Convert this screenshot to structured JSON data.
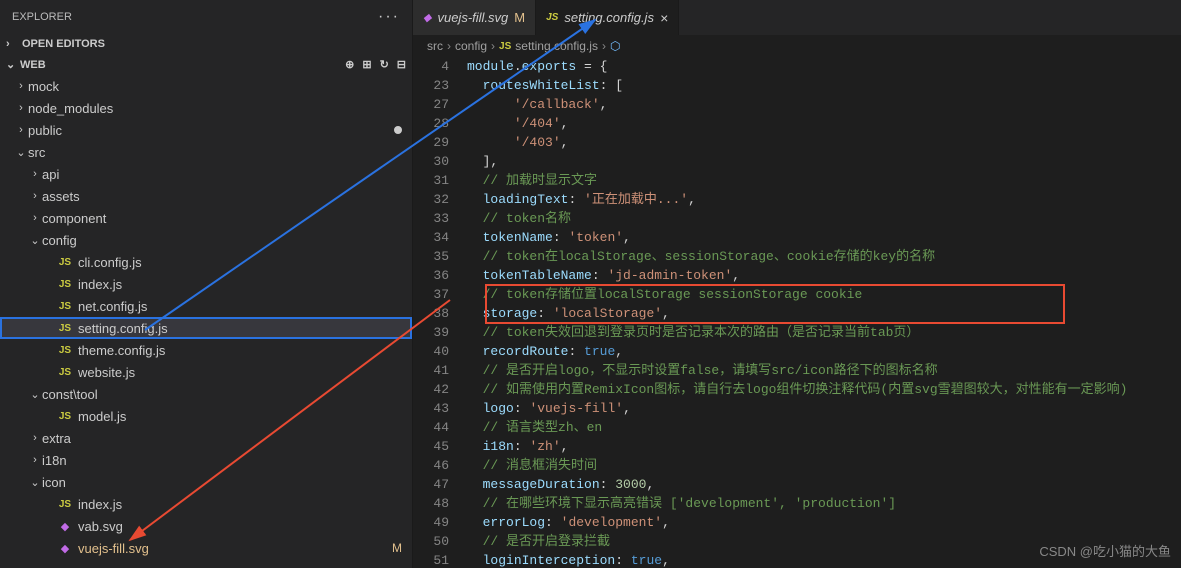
{
  "explorer": {
    "title": "EXPLORER",
    "openEditors": "OPEN EDITORS",
    "workspace": "WEB"
  },
  "tree": [
    {
      "type": "folder",
      "label": "mock",
      "expanded": false,
      "indent": 1
    },
    {
      "type": "folder",
      "label": "node_modules",
      "expanded": false,
      "indent": 1
    },
    {
      "type": "folder",
      "label": "public",
      "expanded": false,
      "indent": 1,
      "modified": true
    },
    {
      "type": "folder",
      "label": "src",
      "expanded": true,
      "indent": 1
    },
    {
      "type": "folder",
      "label": "api",
      "expanded": false,
      "indent": 2
    },
    {
      "type": "folder",
      "label": "assets",
      "expanded": false,
      "indent": 2
    },
    {
      "type": "folder",
      "label": "component",
      "expanded": false,
      "indent": 2
    },
    {
      "type": "folder",
      "label": "config",
      "expanded": true,
      "indent": 2
    },
    {
      "type": "file",
      "label": "cli.config.js",
      "icon": "js",
      "indent": 3
    },
    {
      "type": "file",
      "label": "index.js",
      "icon": "js",
      "indent": 3
    },
    {
      "type": "file",
      "label": "net.config.js",
      "icon": "js",
      "indent": 3
    },
    {
      "type": "file",
      "label": "setting.config.js",
      "icon": "js",
      "indent": 3,
      "highlighted": true
    },
    {
      "type": "file",
      "label": "theme.config.js",
      "icon": "js",
      "indent": 3
    },
    {
      "type": "file",
      "label": "website.js",
      "icon": "js",
      "indent": 3
    },
    {
      "type": "folder",
      "label": "const\\tool",
      "expanded": true,
      "indent": 2
    },
    {
      "type": "file",
      "label": "model.js",
      "icon": "js",
      "indent": 3
    },
    {
      "type": "folder",
      "label": "extra",
      "expanded": false,
      "indent": 2
    },
    {
      "type": "folder",
      "label": "i18n",
      "expanded": false,
      "indent": 2
    },
    {
      "type": "folder",
      "label": "icon",
      "expanded": true,
      "indent": 2
    },
    {
      "type": "file",
      "label": "index.js",
      "icon": "js",
      "indent": 3
    },
    {
      "type": "file",
      "label": "vab.svg",
      "icon": "svg",
      "indent": 3
    },
    {
      "type": "file",
      "label": "vuejs-fill.svg",
      "icon": "svg",
      "indent": 3,
      "modifiedBadge": "M",
      "modifiedLabel": true
    }
  ],
  "tabs": [
    {
      "label": "vuejs-fill.svg",
      "icon": "svg",
      "badge": "M",
      "active": false
    },
    {
      "label": "setting.config.js",
      "icon": "js",
      "active": true,
      "close": true
    }
  ],
  "breadcrumb": [
    "src",
    "config",
    "setting.config.js",
    "<unknown>"
  ],
  "lineNumbers": [
    "4",
    "23",
    "27",
    "28",
    "29",
    "30",
    "31",
    "32",
    "33",
    "34",
    "35",
    "36",
    "37",
    "38",
    "39",
    "40",
    "41",
    "42",
    "43",
    "44",
    "45",
    "46",
    "47",
    "48",
    "49",
    "50",
    "51"
  ],
  "code": [
    [
      {
        "t": "module",
        "c": "prop"
      },
      {
        "t": ".",
        "c": "punc"
      },
      {
        "t": "exports",
        "c": "prop"
      },
      {
        "t": " = {",
        "c": "punc"
      }
    ],
    [
      {
        "t": "  ",
        "c": "punc"
      },
      {
        "t": "routesWhiteList",
        "c": "prop"
      },
      {
        "t": ": [",
        "c": "punc"
      }
    ],
    [
      {
        "t": "      ",
        "c": "punc"
      },
      {
        "t": "'/callback'",
        "c": "str"
      },
      {
        "t": ",",
        "c": "punc"
      }
    ],
    [
      {
        "t": "      ",
        "c": "punc"
      },
      {
        "t": "'/404'",
        "c": "str"
      },
      {
        "t": ",",
        "c": "punc"
      }
    ],
    [
      {
        "t": "      ",
        "c": "punc"
      },
      {
        "t": "'/403'",
        "c": "str"
      },
      {
        "t": ",",
        "c": "punc"
      }
    ],
    [
      {
        "t": "  ],",
        "c": "punc"
      }
    ],
    [
      {
        "t": "  ",
        "c": "punc"
      },
      {
        "t": "// 加载时显示文字",
        "c": "comment"
      }
    ],
    [
      {
        "t": "  ",
        "c": "punc"
      },
      {
        "t": "loadingText",
        "c": "prop"
      },
      {
        "t": ": ",
        "c": "punc"
      },
      {
        "t": "'正在加载中...'",
        "c": "str"
      },
      {
        "t": ",",
        "c": "punc"
      }
    ],
    [
      {
        "t": "  ",
        "c": "punc"
      },
      {
        "t": "// token名称",
        "c": "comment"
      }
    ],
    [
      {
        "t": "  ",
        "c": "punc"
      },
      {
        "t": "tokenName",
        "c": "prop"
      },
      {
        "t": ": ",
        "c": "punc"
      },
      {
        "t": "'token'",
        "c": "str"
      },
      {
        "t": ",",
        "c": "punc"
      }
    ],
    [
      {
        "t": "  ",
        "c": "punc"
      },
      {
        "t": "// token在localStorage、sessionStorage、cookie存储的key的名称",
        "c": "comment"
      }
    ],
    [
      {
        "t": "  ",
        "c": "punc"
      },
      {
        "t": "tokenTableName",
        "c": "prop"
      },
      {
        "t": ": ",
        "c": "punc"
      },
      {
        "t": "'jd-admin-token'",
        "c": "str"
      },
      {
        "t": ",",
        "c": "punc"
      }
    ],
    [
      {
        "t": "  ",
        "c": "punc"
      },
      {
        "t": "// token存储位置localStorage sessionStorage cookie",
        "c": "comment"
      }
    ],
    [
      {
        "t": "  ",
        "c": "punc"
      },
      {
        "t": "storage",
        "c": "prop"
      },
      {
        "t": ": ",
        "c": "punc"
      },
      {
        "t": "'localStorage'",
        "c": "str"
      },
      {
        "t": ",",
        "c": "punc"
      }
    ],
    [
      {
        "t": "  ",
        "c": "punc"
      },
      {
        "t": "// token失效回退到登录页时是否记录本次的路由（是否记录当前tab页）",
        "c": "comment"
      }
    ],
    [
      {
        "t": "  ",
        "c": "punc"
      },
      {
        "t": "recordRoute",
        "c": "prop"
      },
      {
        "t": ": ",
        "c": "punc"
      },
      {
        "t": "true",
        "c": "bool"
      },
      {
        "t": ",",
        "c": "punc"
      }
    ],
    [
      {
        "t": "  ",
        "c": "punc"
      },
      {
        "t": "// 是否开启logo，不显示时设置false，请填写src/icon路径下的图标名称",
        "c": "comment"
      }
    ],
    [
      {
        "t": "  ",
        "c": "punc"
      },
      {
        "t": "// 如需使用内置RemixIcon图标，请自行去logo组件切换注释代码(内置svg雪碧图较大，对性能有一定影响)",
        "c": "comment"
      }
    ],
    [
      {
        "t": "  ",
        "c": "punc"
      },
      {
        "t": "logo",
        "c": "prop"
      },
      {
        "t": ": ",
        "c": "punc"
      },
      {
        "t": "'vuejs-fill'",
        "c": "str"
      },
      {
        "t": ",",
        "c": "punc"
      }
    ],
    [
      {
        "t": "  ",
        "c": "punc"
      },
      {
        "t": "// 语言类型zh、en",
        "c": "comment"
      }
    ],
    [
      {
        "t": "  ",
        "c": "punc"
      },
      {
        "t": "i18n",
        "c": "prop"
      },
      {
        "t": ": ",
        "c": "punc"
      },
      {
        "t": "'zh'",
        "c": "str"
      },
      {
        "t": ",",
        "c": "punc"
      }
    ],
    [
      {
        "t": "  ",
        "c": "punc"
      },
      {
        "t": "// 消息框消失时间",
        "c": "comment"
      }
    ],
    [
      {
        "t": "  ",
        "c": "punc"
      },
      {
        "t": "messageDuration",
        "c": "prop"
      },
      {
        "t": ": ",
        "c": "punc"
      },
      {
        "t": "3000",
        "c": "num"
      },
      {
        "t": ",",
        "c": "punc"
      }
    ],
    [
      {
        "t": "  ",
        "c": "punc"
      },
      {
        "t": "// 在哪些环境下显示高亮错误 ['development', 'production']",
        "c": "comment"
      }
    ],
    [
      {
        "t": "  ",
        "c": "punc"
      },
      {
        "t": "errorLog",
        "c": "prop"
      },
      {
        "t": ": ",
        "c": "punc"
      },
      {
        "t": "'development'",
        "c": "str"
      },
      {
        "t": ",",
        "c": "punc"
      }
    ],
    [
      {
        "t": "  ",
        "c": "punc"
      },
      {
        "t": "// 是否开启登录拦截",
        "c": "comment"
      }
    ],
    [
      {
        "t": "  ",
        "c": "punc"
      },
      {
        "t": "loginInterception",
        "c": "prop"
      },
      {
        "t": ": ",
        "c": "punc"
      },
      {
        "t": "true",
        "c": "bool"
      },
      {
        "t": ",",
        "c": "punc"
      }
    ]
  ],
  "watermark": "CSDN @吃小猫的大鱼"
}
